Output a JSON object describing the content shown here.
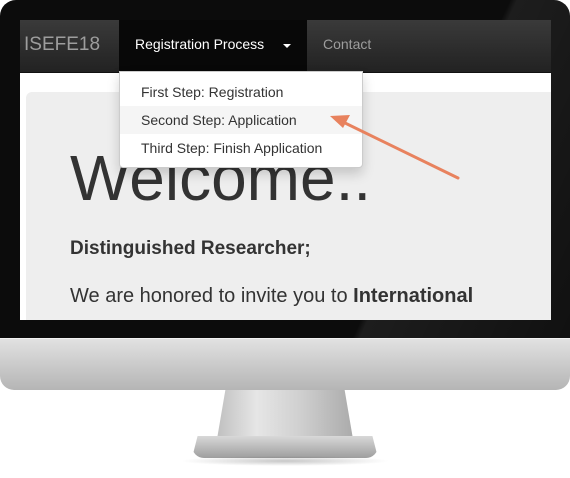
{
  "navbar": {
    "brand": "ISEFE18",
    "registration_menu_label": "Registration Process",
    "contact_label": "Contact"
  },
  "dropdown": {
    "items": [
      {
        "label": "First Step: Registration"
      },
      {
        "label": "Second Step: Application"
      },
      {
        "label": "Third Step: Finish Application"
      }
    ]
  },
  "jumbotron": {
    "heading": "Welcome..",
    "subheading": "Distinguished Researcher;",
    "invite_text": "We are honored to invite you to ",
    "invite_bold": "International"
  },
  "colors": {
    "navbar_bg": "#222222",
    "arrow": "#e8825e",
    "jumbotron_bg": "#eeeeee"
  },
  "icons": [
    "caret-down-icon",
    "pointer-arrow-icon"
  ]
}
